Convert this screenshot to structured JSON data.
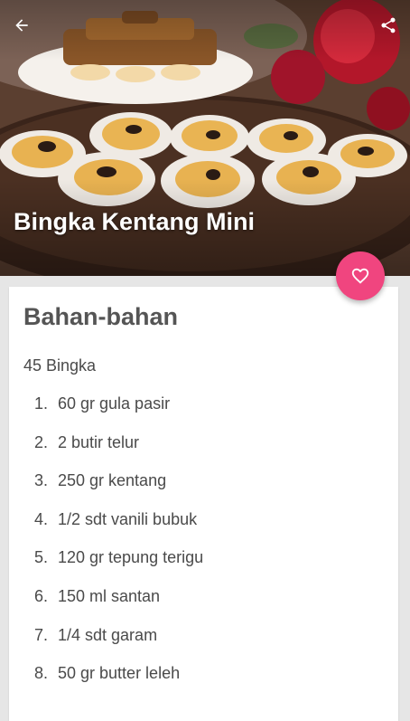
{
  "header": {
    "title": "Bingka Kentang Mini",
    "back_icon": "arrow-left-icon",
    "share_icon": "share-icon"
  },
  "favorite": {
    "icon": "heart-outline-icon",
    "color": "#f0457f"
  },
  "recipe": {
    "section_title": "Bahan-bahan",
    "servings": "45 Bingka",
    "ingredients": [
      {
        "num": "1.",
        "text": "60 gr gula pasir"
      },
      {
        "num": "2.",
        "text": "2 butir telur"
      },
      {
        "num": "3.",
        "text": "250 gr kentang"
      },
      {
        "num": "4.",
        "text": "1/2 sdt vanili bubuk"
      },
      {
        "num": "5.",
        "text": "120 gr tepung terigu"
      },
      {
        "num": "6.",
        "text": "150 ml santan"
      },
      {
        "num": "7.",
        "text": "1/4 sdt garam"
      },
      {
        "num": "8.",
        "text": "50 gr butter leleh"
      }
    ]
  }
}
